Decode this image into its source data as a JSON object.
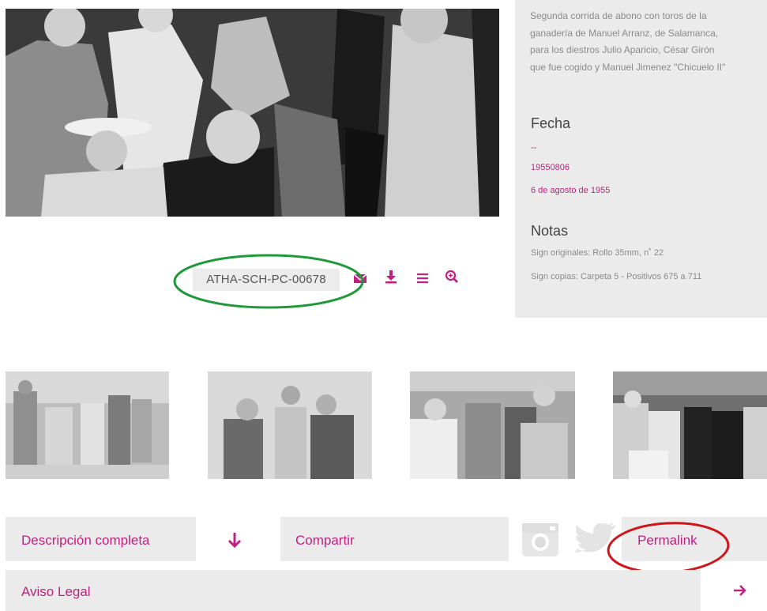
{
  "description": {
    "text": "Segunda corrida de abono con toros de la ganadería de Manuel Arranz, de Salamanca, para los diestros Julio Aparicio, César Girón que fue cogido y Manuel Jimenez \"Chicuelo II\"",
    "lines": [
      "Segunda corrida de abono con toros de la",
      "ganadería de Manuel Arranz, de Salamanca,",
      "para los diestros Julio Aparicio, César Girón",
      "que fue cogido y Manuel Jimenez \"Chicuelo II\""
    ]
  },
  "fecha": {
    "title": "Fecha",
    "dash": "--",
    "raw": "19550806",
    "formatted": "6 de agosto de 1955"
  },
  "notas": {
    "title": "Notas",
    "line1": "Sign originales: Rollo 35mm, n˚ 22",
    "line2": "Sign copias: Carpeta 5 - Positivos 675 a 711"
  },
  "record": {
    "code": "ATHA-SCH-PC-00678"
  },
  "toolbar": {
    "icons": [
      "envelope-icon",
      "download-icon",
      "list-icon",
      "zoom-in-icon"
    ]
  },
  "bottom": {
    "descripcion_label": "Descripción completa",
    "compartir_label": "Compartir",
    "permalink_label": "Permalink",
    "aviso_label": "Aviso Legal"
  },
  "colors": {
    "accent": "#c0207f",
    "panel": "#ebebeb",
    "annotation_green": "#1f9a3a",
    "annotation_red": "#d0141a"
  }
}
